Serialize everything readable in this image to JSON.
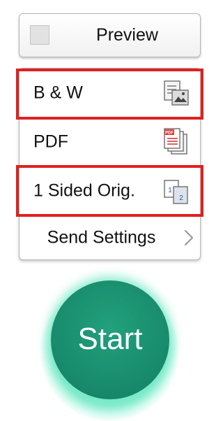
{
  "preview": {
    "label": "Preview",
    "checked": false
  },
  "settings": {
    "color_mode": {
      "label": "B & W",
      "icon": "bw-document-icon",
      "highlighted": true
    },
    "file_type": {
      "label": "PDF",
      "icon": "pdf-document-icon",
      "highlighted": false
    },
    "original_sides": {
      "label": "1 Sided Orig.",
      "icon": "one-sided-original-icon",
      "highlighted": true,
      "icon_text": [
        "1",
        "2"
      ]
    },
    "send_settings": {
      "label": "Send Settings",
      "icon": "chevron-right-icon"
    }
  },
  "start": {
    "label": "Start"
  },
  "colors": {
    "highlight": "#e02020",
    "start": "#17896a",
    "pdf_icon": "#d83a3a"
  },
  "pdf_icon_text": "PDF"
}
